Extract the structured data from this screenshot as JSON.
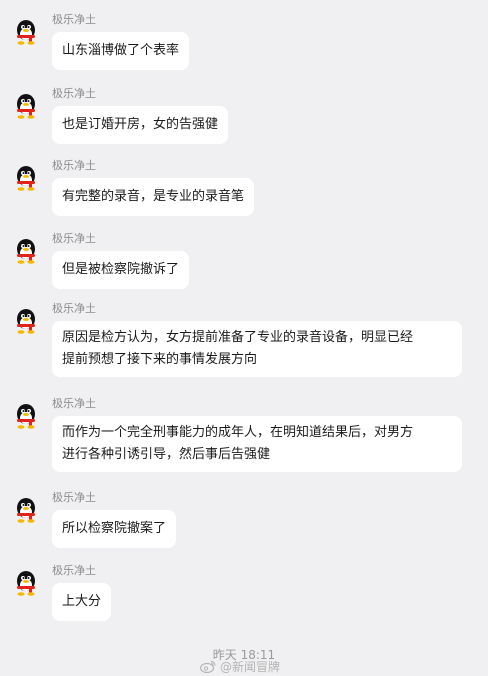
{
  "sender": {
    "name": "极乐净土",
    "avatar": "penguin-avatar"
  },
  "messages": [
    {
      "lines": [
        "山东淄博做了个表率"
      ]
    },
    {
      "lines": [
        "也是订婚开房，女的告强健"
      ]
    },
    {
      "lines": [
        "有完整的录音，是专业的录音笔"
      ]
    },
    {
      "lines": [
        "但是被检察院撤诉了"
      ]
    },
    {
      "lines": [
        "原因是检方认为，女方提前准备了专业的录音设备，明显已经",
        "提前预想了接下来的事情发展方向"
      ]
    },
    {
      "lines": [
        "而作为一个完全刑事能力的成年人，在明知道结果后，对男方",
        "进行各种引诱引导，然后事后告强健"
      ]
    },
    {
      "lines": [
        "所以检察院撤案了"
      ]
    },
    {
      "lines": [
        "上大分"
      ]
    }
  ],
  "footer": {
    "timestamp": "昨天 18:11",
    "watermark": "@新闻冒牌",
    "watermark_icon": "weibo-logo-icon"
  },
  "colors": {
    "background": "#f0f0f2",
    "bubble": "#ffffff",
    "name_text": "#8c8c8c",
    "message_text": "#1a1a1a",
    "avatar_scarf": "#e2231a"
  }
}
